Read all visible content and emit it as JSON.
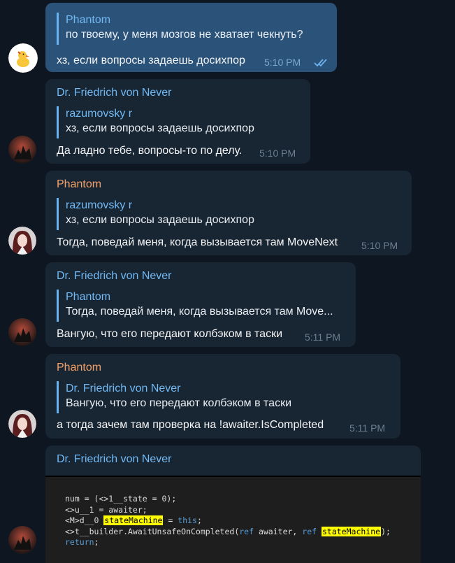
{
  "messages": [
    {
      "id": "m1",
      "reply_name": "Phantom",
      "reply_text": "по твоему, у меня мозгов не хватает чекнуть?",
      "text": "хз, если вопросы задаешь досихпор",
      "time": "5:10 PM"
    },
    {
      "id": "m2",
      "sender": "Dr. Friedrich von Never",
      "reply_name": "razumovsky r",
      "reply_text": "хз, если вопросы задаешь досихпор",
      "text": "Да ладно тебе, вопросы-то по делу.",
      "time": "5:10 PM"
    },
    {
      "id": "m3",
      "sender": "Phantom",
      "reply_name": "razumovsky r",
      "reply_text": "хз, если вопросы задаешь досихпор",
      "text": "Тогда, поведай меня, когда вызывается там MoveNext",
      "time": "5:10 PM"
    },
    {
      "id": "m4",
      "sender": "Dr. Friedrich von Never",
      "reply_name": "Phantom",
      "reply_text": "Тогда, поведай меня, когда вызывается там Move...",
      "text": "Вангую, что его передают колбэком в таски",
      "time": "5:11 PM"
    },
    {
      "id": "m5",
      "sender": "Phantom",
      "reply_name": "Dr. Friedrich von Never",
      "reply_text": "Вангую, что его передают колбэком в таски",
      "text": "а тогда зачем там проверка на !awaiter.IsCompleted",
      "time": "5:11 PM"
    },
    {
      "id": "m6",
      "sender": "Dr. Friedrich von Never",
      "code": {
        "line1": "num = (<>1__state = 0);",
        "line2": "<>u__1 = awaiter;",
        "line3_a": "<M>d__0 ",
        "line3_hl": "stateMachine",
        "line3_b": " = ",
        "line3_kw": "this",
        "line3_c": ";",
        "line4_a": "<>t__builder.AwaitUnsafeOnCompleted(",
        "line4_kw1": "ref",
        "line4_b": " awaiter, ",
        "line4_kw2": "ref",
        "line4_c": " ",
        "line4_hl": "stateMachine",
        "line4_d": ");",
        "line5_kw": "return",
        "line5_a": ";"
      }
    }
  ],
  "colors": {
    "background": "#0e1621",
    "incoming_bubble": "#182533",
    "outgoing_bubble": "#2b5278",
    "name_blue": "#71baf5",
    "name_orange": "#f4a16a",
    "highlight": "#fffb00"
  },
  "icons": {
    "read_status": "double-check-icon",
    "avatar_phantom": "duck-sticker-avatar",
    "avatar_friedrich": "dark-silhouette-avatar",
    "avatar_anime": "anime-girl-avatar"
  }
}
